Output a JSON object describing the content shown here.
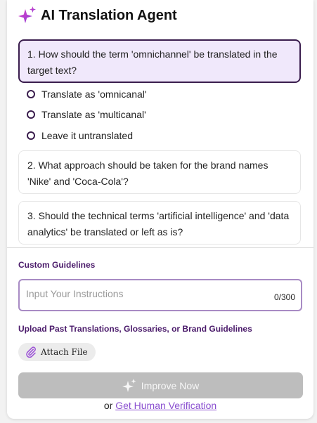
{
  "header": {
    "title": "AI Translation Agent",
    "icon": "sparkles-icon"
  },
  "questions": [
    {
      "text": "1. How should the term 'omnichannel' be translated in the target text?",
      "active": true,
      "options": [
        "Translate as 'omnicanal'",
        "Translate as 'multicanal'",
        "Leave it untranslated"
      ]
    },
    {
      "text": "2. What approach should be taken for the brand names 'Nike' and 'Coca-Cola'?",
      "active": false
    },
    {
      "text": "3. Should the technical terms 'artificial intelligence' and 'data analytics' be translated or left as is?",
      "active": false
    }
  ],
  "guidelines": {
    "label": "Custom Guidelines",
    "placeholder": "Input Your Instructions",
    "counter": "0/300"
  },
  "upload": {
    "label": "Upload Past Translations, Glossaries, or Brand Guidelines",
    "attach_label": "Attach File",
    "icon": "paperclip-icon"
  },
  "actions": {
    "improve_label": "Improve Now",
    "or_text": "or",
    "verify_link": "Get Human Verification"
  },
  "colors": {
    "accent": "#3a1d4d",
    "active_bg": "#f0e8fb",
    "sparkle_gradient": [
      "#e040c8",
      "#8a3fd6"
    ],
    "link": "#8a4fd0",
    "disabled_button": "#bdbdbd"
  }
}
